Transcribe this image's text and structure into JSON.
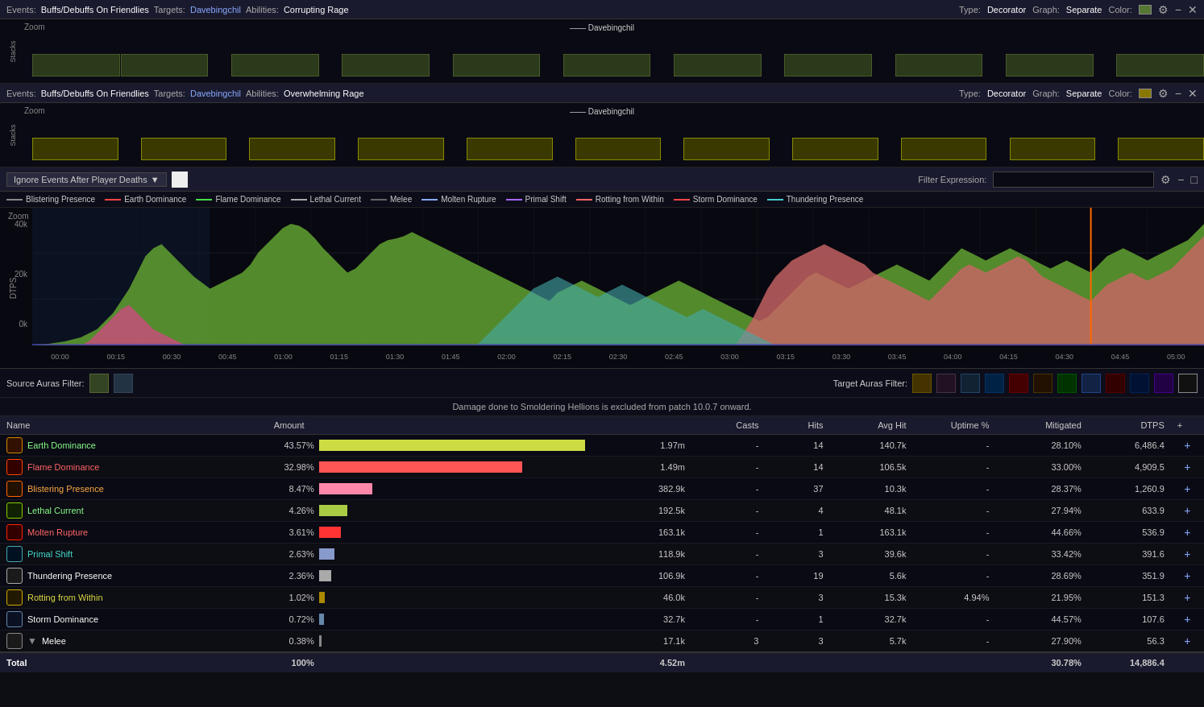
{
  "topBars": [
    {
      "events": "Buffs/Debuffs On Friendlies",
      "targets_label": "Targets:",
      "targets": "Davebingchil",
      "abilities_label": "Abilities:",
      "abilities": "Corrupting Rage",
      "type_label": "Type:",
      "type": "Decorator",
      "graph_label": "Graph:",
      "graph": "Separate",
      "color_label": "Color:"
    },
    {
      "events": "Buffs/Debuffs On Friendlies",
      "targets_label": "Targets:",
      "targets": "Davebingchil",
      "abilities_label": "Abilities:",
      "abilities": "Overwhelming Rage",
      "type_label": "Type:",
      "type": "Decorator",
      "graph_label": "Graph:",
      "graph": "Separate",
      "color_label": "Color:"
    }
  ],
  "stacksLegend": "Davebingchil",
  "controls": {
    "ignoreLabel": "Ignore Events After Player Deaths",
    "filterLabel": "Filter Expression:",
    "filterPlaceholder": ""
  },
  "legend": {
    "items": [
      {
        "name": "Blistering Presence",
        "color": "#888888"
      },
      {
        "name": "Earth Dominance",
        "color": "#ff4444"
      },
      {
        "name": "Flame Dominance",
        "color": "#44dd44"
      },
      {
        "name": "Lethal Current",
        "color": "#aaaaaa"
      },
      {
        "name": "Melee",
        "color": "#666666"
      },
      {
        "name": "Molten Rupture",
        "color": "#88aaff"
      },
      {
        "name": "Primal Shift",
        "color": "#aa66ff"
      },
      {
        "name": "Rotting from Within",
        "color": "#ff6666"
      },
      {
        "name": "Storm Dominance",
        "color": "#ff4444"
      },
      {
        "name": "Thundering Presence",
        "color": "#44cccc"
      }
    ]
  },
  "chart": {
    "zoomLabel": "Zoom",
    "yLabels": [
      "40k",
      "20k",
      "0k"
    ],
    "dtpsLabel": "DTPS",
    "xTicks": [
      "00:00",
      "00:15",
      "00:30",
      "00:45",
      "01:00",
      "01:15",
      "01:30",
      "01:45",
      "02:00",
      "02:15",
      "02:30",
      "02:45",
      "03:00",
      "03:15",
      "03:30",
      "03:45",
      "04:00",
      "04:15",
      "04:30",
      "04:45",
      "05:00"
    ]
  },
  "notice": "Damage done to Smoldering Hellions is excluded from patch 10.0.7 onward.",
  "tableHeaders": {
    "name": "Name",
    "amount": "Amount",
    "casts": "Casts",
    "hits": "Hits",
    "avgHit": "Avg Hit",
    "uptime": "Uptime %",
    "mitigated": "Mitigated",
    "dtps": "DTPS"
  },
  "tableRows": [
    {
      "name": "Earth Dominance",
      "nameColor": "green",
      "iconColor": "#cc8800",
      "iconBg": "#331100",
      "pct": "43.57%",
      "barWidth": 85,
      "barColor": "#ccdd44",
      "amount": "1.97m",
      "casts": "-",
      "hits": "14",
      "avgHit": "140.7k",
      "uptime": "-",
      "mitigated": "28.10%",
      "dtps": "6,486.4",
      "hasExpand": false
    },
    {
      "name": "Flame Dominance",
      "nameColor": "red",
      "iconColor": "#ff4400",
      "iconBg": "#330000",
      "pct": "32.98%",
      "barWidth": 65,
      "barColor": "#ff5555",
      "amount": "1.49m",
      "casts": "-",
      "hits": "14",
      "avgHit": "106.5k",
      "uptime": "-",
      "mitigated": "33.00%",
      "dtps": "4,909.5",
      "hasExpand": false
    },
    {
      "name": "Blistering Presence",
      "nameColor": "orange",
      "iconColor": "#ff6600",
      "iconBg": "#221100",
      "pct": "8.47%",
      "barWidth": 17,
      "barColor": "#ff88aa",
      "amount": "382.9k",
      "casts": "-",
      "hits": "37",
      "avgHit": "10.3k",
      "uptime": "-",
      "mitigated": "28.37%",
      "dtps": "1,260.9",
      "hasExpand": false
    },
    {
      "name": "Lethal Current",
      "nameColor": "green",
      "iconColor": "#88cc00",
      "iconBg": "#112200",
      "pct": "4.26%",
      "barWidth": 9,
      "barColor": "#aacc44",
      "amount": "192.5k",
      "casts": "-",
      "hits": "4",
      "avgHit": "48.1k",
      "uptime": "-",
      "mitigated": "27.94%",
      "dtps": "633.9",
      "hasExpand": false
    },
    {
      "name": "Molten Rupture",
      "nameColor": "red",
      "iconColor": "#ff2200",
      "iconBg": "#330000",
      "pct": "3.61%",
      "barWidth": 7,
      "barColor": "#ff3333",
      "amount": "163.1k",
      "casts": "-",
      "hits": "1",
      "avgHit": "163.1k",
      "uptime": "-",
      "mitigated": "44.66%",
      "dtps": "536.9",
      "hasExpand": false
    },
    {
      "name": "Primal Shift",
      "nameColor": "teal",
      "iconColor": "#44aaaa",
      "iconBg": "#001122",
      "pct": "2.63%",
      "barWidth": 5,
      "barColor": "#8899cc",
      "amount": "118.9k",
      "casts": "-",
      "hits": "3",
      "avgHit": "39.6k",
      "uptime": "-",
      "mitigated": "33.42%",
      "dtps": "391.6",
      "hasExpand": false
    },
    {
      "name": "Thundering Presence",
      "nameColor": "white",
      "iconColor": "#aaaaaa",
      "iconBg": "#1a1a1a",
      "pct": "2.36%",
      "barWidth": 4,
      "barColor": "#aaaaaa",
      "amount": "106.9k",
      "casts": "-",
      "hits": "19",
      "avgHit": "5.6k",
      "uptime": "-",
      "mitigated": "28.69%",
      "dtps": "351.9",
      "hasExpand": false
    },
    {
      "name": "Rotting from Within",
      "nameColor": "yellow",
      "iconColor": "#ccaa00",
      "iconBg": "#221a00",
      "pct": "1.02%",
      "barWidth": 2,
      "barColor": "#aa8800",
      "amount": "46.0k",
      "casts": "-",
      "hits": "3",
      "avgHit": "15.3k",
      "uptime": "4.94%",
      "mitigated": "21.95%",
      "dtps": "151.3",
      "hasExpand": false
    },
    {
      "name": "Storm Dominance",
      "nameColor": "white",
      "iconColor": "#6688aa",
      "iconBg": "#0a1122",
      "pct": "0.72%",
      "barWidth": 1.5,
      "barColor": "#6688aa",
      "amount": "32.7k",
      "casts": "-",
      "hits": "1",
      "avgHit": "32.7k",
      "uptime": "-",
      "mitigated": "44.57%",
      "dtps": "107.6",
      "hasExpand": false
    },
    {
      "name": "Melee",
      "nameColor": "white",
      "iconColor": "#888888",
      "iconBg": "#1a1a1a",
      "pct": "0.38%",
      "barWidth": 0.8,
      "barColor": "#888888",
      "amount": "17.1k",
      "casts": "3",
      "hits": "3",
      "avgHit": "5.7k",
      "uptime": "-",
      "mitigated": "27.90%",
      "dtps": "56.3",
      "hasExpand": true
    }
  ],
  "tableFooter": {
    "label": "Total",
    "pct": "100%",
    "amount": "4.52m",
    "casts": "",
    "hits": "",
    "avgHit": "",
    "uptime": "",
    "mitigated": "30.78%",
    "dtps": "14,886.4"
  },
  "sourceAurasLabel": "Source Auras Filter:",
  "targetAurasLabel": "Target Auras Filter:"
}
